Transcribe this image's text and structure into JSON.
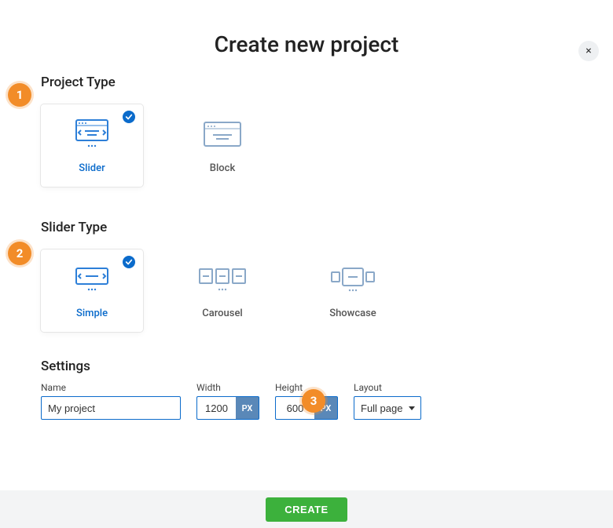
{
  "title": "Create new project",
  "close_label": "×",
  "steps": {
    "one": "1",
    "two": "2",
    "settings_badge": "3"
  },
  "project_type": {
    "heading": "Project Type",
    "options": [
      {
        "label": "Slider",
        "selected": true
      },
      {
        "label": "Block",
        "selected": false
      }
    ]
  },
  "slider_type": {
    "heading": "Slider Type",
    "options": [
      {
        "label": "Simple",
        "selected": true
      },
      {
        "label": "Carousel",
        "selected": false
      },
      {
        "label": "Showcase",
        "selected": false
      }
    ]
  },
  "settings": {
    "heading": "Settings",
    "name": {
      "label": "Name",
      "value": "My project"
    },
    "width": {
      "label": "Width",
      "value": "1200",
      "unit": "PX"
    },
    "height": {
      "label": "Height",
      "value": "600",
      "unit": "PX"
    },
    "layout": {
      "label": "Layout",
      "value": "Full page"
    }
  },
  "create_label": "CREATE"
}
